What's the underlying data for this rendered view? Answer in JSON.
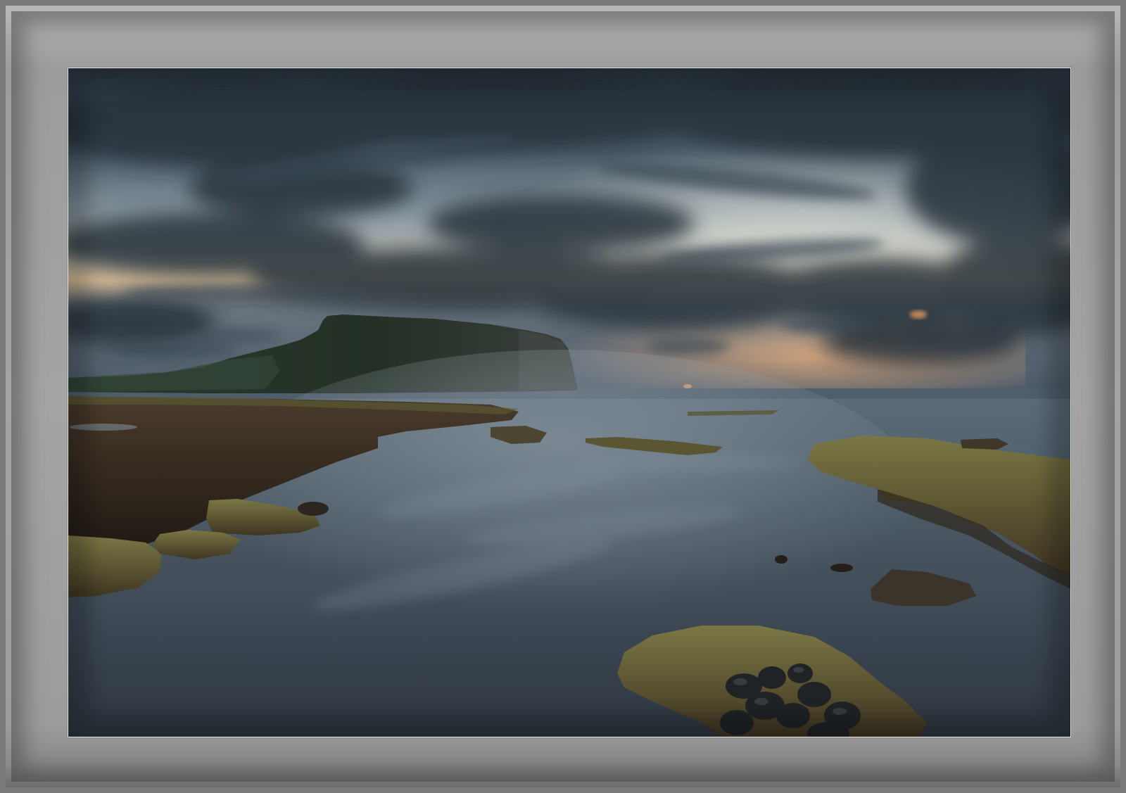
{
  "photo": {
    "subject": "coastal-seascape",
    "colors": {
      "sky_top": "#36434f",
      "sky_glow": "#e8c39a",
      "horizon_sea": "#4e5f6e",
      "water": "#3c4a58",
      "headland": "#24302a",
      "rock": "#3a3126",
      "moss": "#6d6a3c"
    }
  }
}
